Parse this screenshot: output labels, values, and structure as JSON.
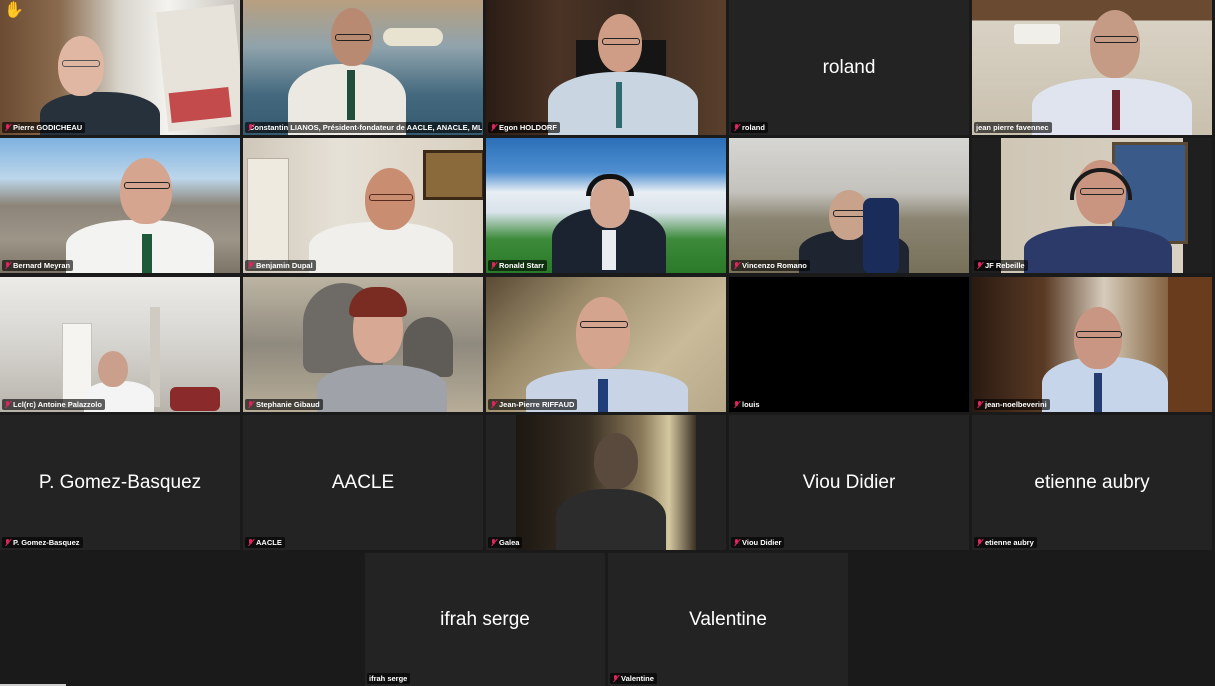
{
  "participants": [
    {
      "name": "Pierre GODICHEAU",
      "display": "",
      "mic_muted": true,
      "raised_hand": true,
      "speaking": true
    },
    {
      "name": "Constantin LIANOS, Président-fondateur de AACLE, ANACLE, ML et s...",
      "display": "",
      "mic_muted": true
    },
    {
      "name": "Egon HOLDORF",
      "display": "",
      "mic_muted": true
    },
    {
      "name": "roland",
      "display": "roland",
      "mic_muted": true
    },
    {
      "name": "jean pierre favennec",
      "display": "",
      "mic_muted": false
    },
    {
      "name": "Bernard Meyran",
      "display": "",
      "mic_muted": true
    },
    {
      "name": "Benjamin Dupal",
      "display": "",
      "mic_muted": true
    },
    {
      "name": "Ronald Starr",
      "display": "",
      "mic_muted": true
    },
    {
      "name": "Vincenzo Romano",
      "display": "",
      "mic_muted": true
    },
    {
      "name": "JF Rebeille",
      "display": "",
      "mic_muted": true
    },
    {
      "name": "Lcl(rc) Antoine Palazzolo",
      "display": "",
      "mic_muted": true
    },
    {
      "name": "Stephanie Gibaud",
      "display": "",
      "mic_muted": true
    },
    {
      "name": "Jean-Pierre RIFFAUD",
      "display": "",
      "mic_muted": true
    },
    {
      "name": "louis",
      "display": "",
      "mic_muted": true
    },
    {
      "name": "jean-noelbeverini",
      "display": "",
      "mic_muted": true
    },
    {
      "name": "P. Gomez-Basquez",
      "display": "P. Gomez-Basquez",
      "mic_muted": true
    },
    {
      "name": "AACLE",
      "display": "AACLE",
      "mic_muted": true
    },
    {
      "name": "Galea",
      "display": "",
      "mic_muted": true
    },
    {
      "name": "Viou Didier",
      "display": "Viou Didier",
      "mic_muted": true
    },
    {
      "name": "etienne aubry",
      "display": "etienne aubry",
      "mic_muted": true
    },
    {
      "name": "ifrah serge",
      "display": "ifrah serge",
      "mic_muted": false
    },
    {
      "name": "Valentine",
      "display": "Valentine",
      "mic_muted": true
    }
  ],
  "colors": {
    "background": "#1a1a1a",
    "tile": "#232323",
    "active_speaker": "#23d959",
    "muted_icon": "#e0245e"
  }
}
